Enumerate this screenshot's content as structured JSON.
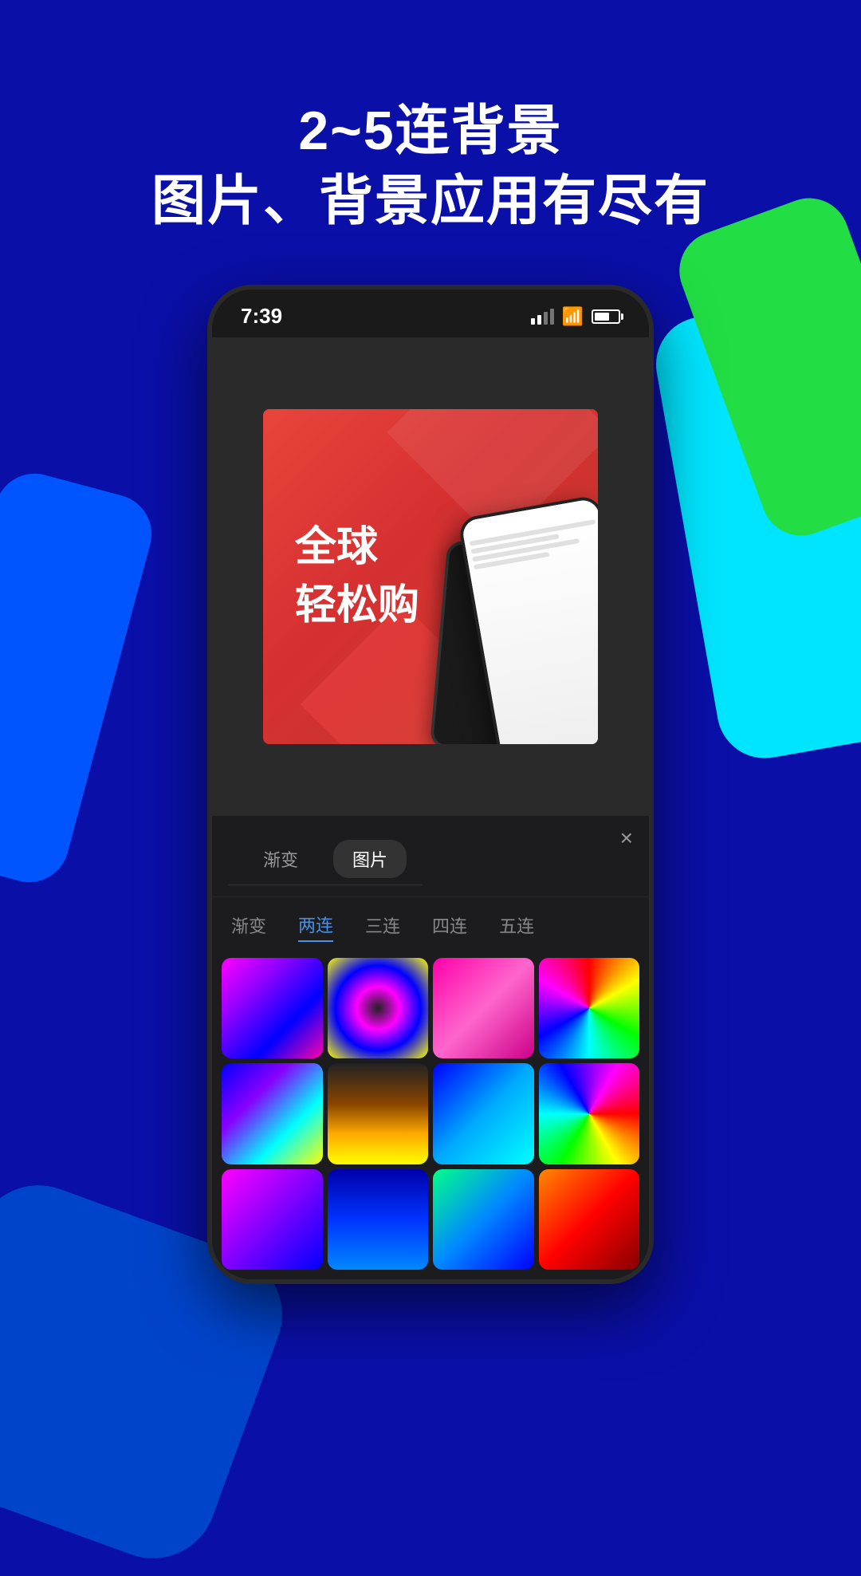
{
  "page": {
    "background_color": "#0a0fa8"
  },
  "title": {
    "line1": "2~5连背景",
    "line2": "图片、背景应用有尽有"
  },
  "phone": {
    "status_bar": {
      "time": "7:39",
      "signal": "signal-icon",
      "wifi": "wifi-icon",
      "battery": "battery-icon"
    },
    "preview": {
      "text_line1": "全球",
      "text_line2": "轻松购"
    },
    "tabs": {
      "tab1": "渐变",
      "tab2": "图片",
      "close": "×"
    },
    "sub_tabs": [
      {
        "label": "渐变",
        "active": false
      },
      {
        "label": "两连",
        "active": true
      },
      {
        "label": "三连",
        "active": false
      },
      {
        "label": "四连",
        "active": false
      },
      {
        "label": "五连",
        "active": false
      }
    ]
  }
}
